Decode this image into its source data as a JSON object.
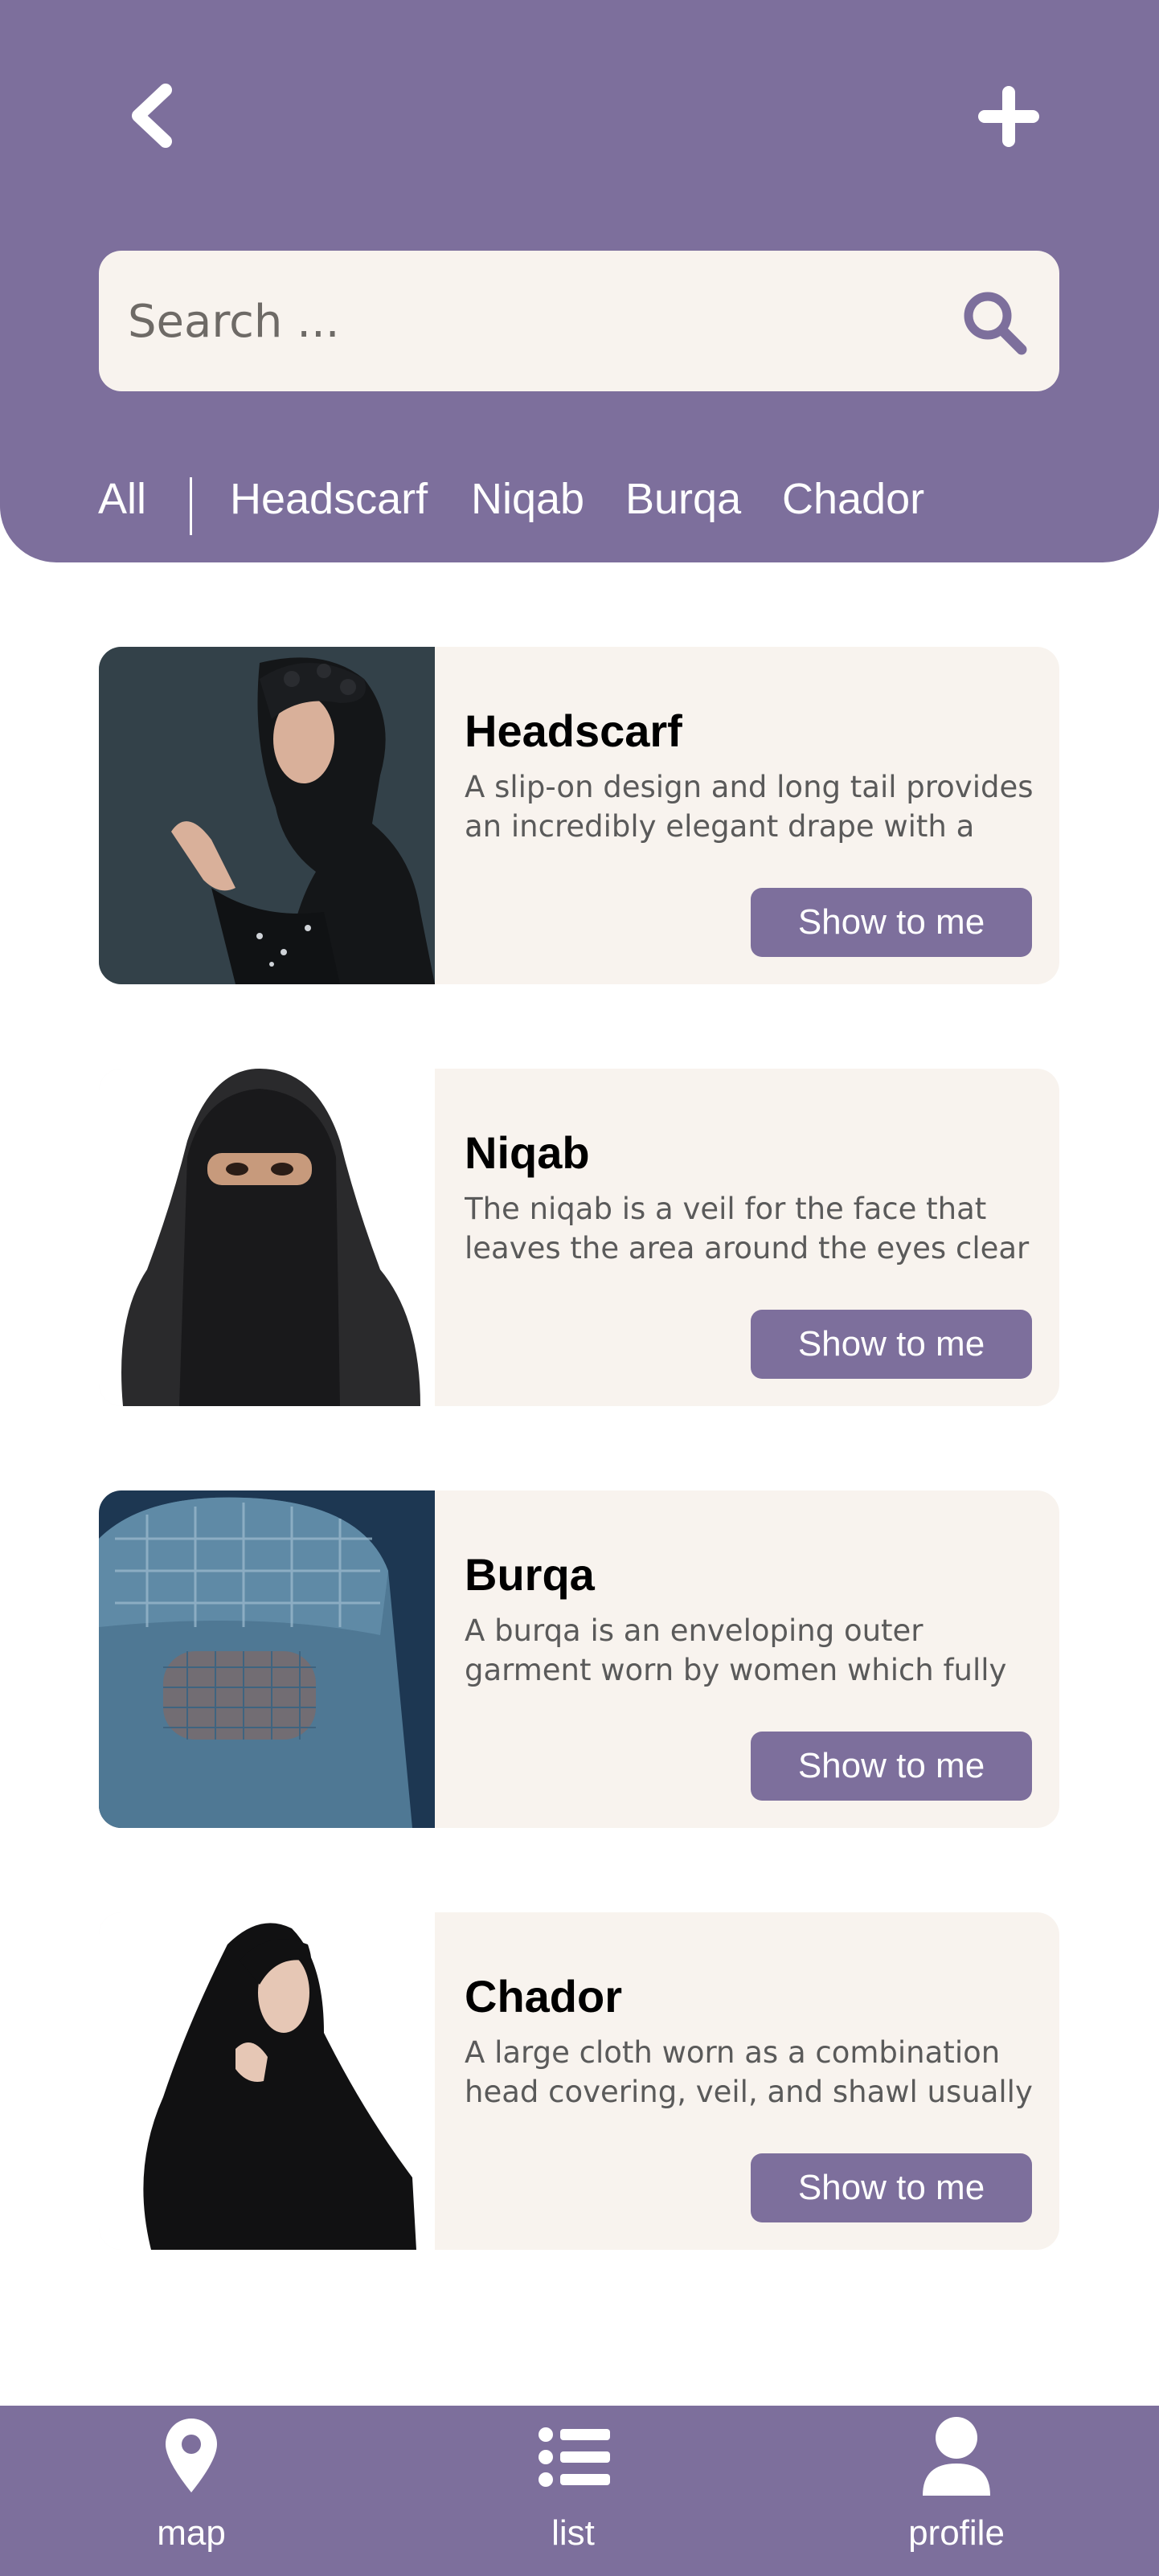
{
  "header": {
    "back_icon": "chevron-left-icon",
    "add_icon": "plus-icon",
    "search": {
      "placeholder": "Search ...",
      "value": "",
      "icon": "search-icon"
    },
    "filters": [
      {
        "label": "All"
      },
      {
        "label": "Headscarf"
      },
      {
        "label": "Niqab"
      },
      {
        "label": "Burqa"
      },
      {
        "label": "Chador"
      }
    ]
  },
  "items": [
    {
      "title": "Headscarf",
      "description": "A slip-on design and long tail provides an incredibly elegant drape with a variety of styling options for everyday wear.",
      "button": "Show to me"
    },
    {
      "title": "Niqab",
      "description": "The niqab is a veil for the face that leaves the area around the eyes clear",
      "button": "Show to me"
    },
    {
      "title": "Burqa",
      "description": "A burqa is an enveloping outer garment worn by women which fully covers the body and the face in some traditions.",
      "button": "Show to me"
    },
    {
      "title": "Chador",
      "description": "A large cloth worn as a combination head covering, veil, and shawl usually by women in public spaces.",
      "button": "Show to me"
    }
  ],
  "bottom_nav": [
    {
      "label": "map",
      "icon": "map-pin-icon"
    },
    {
      "label": "list",
      "icon": "list-icon"
    },
    {
      "label": "profile",
      "icon": "user-icon"
    }
  ],
  "colors": {
    "primary": "#7d6f9c",
    "card_background": "#f8f3ee",
    "text_dark": "#000000",
    "text_muted": "#5a5a5a"
  }
}
